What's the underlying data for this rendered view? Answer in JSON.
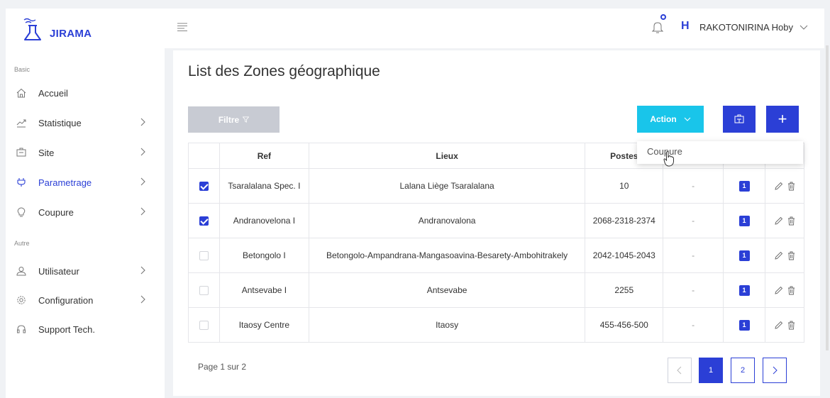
{
  "app": {
    "name": "JIRAMA"
  },
  "sidebar": {
    "sections": [
      {
        "label": "Basic"
      },
      {
        "label": "Autre"
      }
    ],
    "items": [
      {
        "label": "Accueil",
        "icon": "home-icon",
        "has_children": false,
        "active": false
      },
      {
        "label": "Statistique",
        "icon": "chart-icon",
        "has_children": true,
        "active": false
      },
      {
        "label": "Site",
        "icon": "site-icon",
        "has_children": true,
        "active": false
      },
      {
        "label": "Parametrage",
        "icon": "plug-icon",
        "has_children": true,
        "active": true
      },
      {
        "label": "Coupure",
        "icon": "bulb-icon",
        "has_children": true,
        "active": false
      },
      {
        "label": "Utilisateur",
        "icon": "user-icon",
        "has_children": true,
        "active": false
      },
      {
        "label": "Configuration",
        "icon": "gear-icon",
        "has_children": true,
        "active": false
      },
      {
        "label": "Support Tech.",
        "icon": "headset-icon",
        "has_children": false,
        "active": false
      }
    ]
  },
  "header": {
    "avatar_letter": "H",
    "user_name": "RAKOTONIRINA Hoby"
  },
  "main": {
    "title": "List des Zones géographique",
    "filter_label": "Filtre",
    "action_label": "Action",
    "add_label": "+",
    "dropdown_items": [
      "Coupure"
    ],
    "columns": [
      "Ref",
      "Lieux",
      "Postes",
      "",
      "",
      ""
    ],
    "rows": [
      {
        "checked": true,
        "ref": "Tsaralalana Spec. I",
        "lieux": "Lalana Liège Tsaralalana",
        "postes": "10",
        "dash": "-",
        "badge": "1"
      },
      {
        "checked": true,
        "ref": "Andranovelona I",
        "lieux": "Andranovalona",
        "postes": "2068-2318-2374",
        "dash": "-",
        "badge": "1"
      },
      {
        "checked": false,
        "ref": "Betongolo I",
        "lieux": "Betongolo-Ampandrana-Mangasoavina-Besarety-Ambohitrakely",
        "postes": "2042-1045-2043",
        "dash": "-",
        "badge": "1"
      },
      {
        "checked": false,
        "ref": "Antsevabe I",
        "lieux": "Antsevabe",
        "postes": "2255",
        "dash": "-",
        "badge": "1"
      },
      {
        "checked": false,
        "ref": "Itaosy Centre",
        "lieux": "Itaosy",
        "postes": "455-456-500",
        "dash": "-",
        "badge": "1"
      }
    ],
    "pagination": {
      "info": "Page 1 sur 2",
      "pages": [
        "1",
        "2"
      ],
      "current": "1"
    }
  },
  "colors": {
    "brand": "#2b3fd6",
    "action": "#19c5ea",
    "filter_disabled": "#c8cbd3"
  }
}
